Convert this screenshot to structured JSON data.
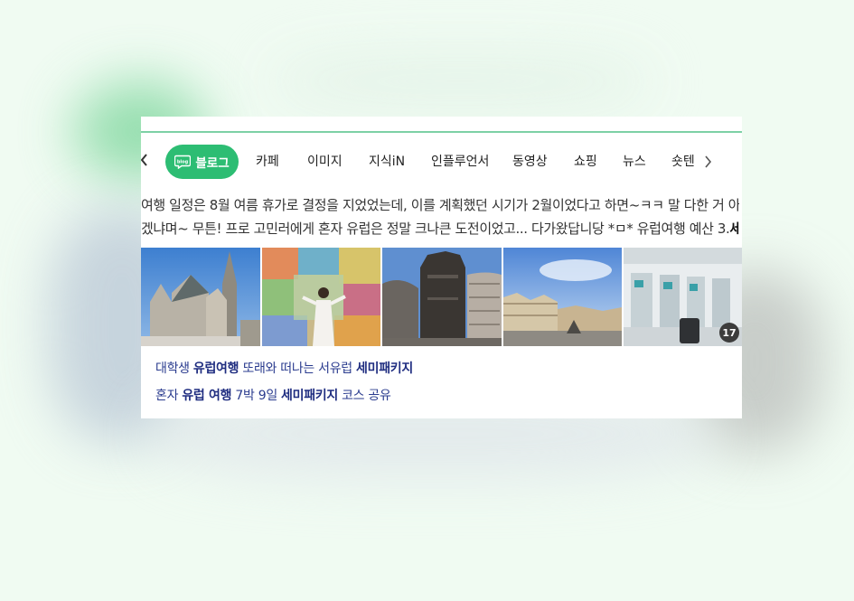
{
  "tabs": {
    "active": "블로그",
    "items": [
      "카페",
      "이미지",
      "지식iN",
      "인플루언서",
      "동영상",
      "쇼핑",
      "뉴스",
      "숏텐"
    ]
  },
  "snippet": {
    "line1": "여행 일정은 8월 여름 휴가로 결정을 지었었는데, 이를 계획했던 시기가 2월이었다고 하면~ㅋㅋ 말 다한 거 아니",
    "line2_text": "겠냐며~ 무튼! 프로 고민러에게 혼자 유럽은 정말 크나큰 도전이었고... 다가왔답니당 *ㅁ* 유럽여행 예산 3.",
    "line2_bold": "세..."
  },
  "gallery": {
    "image_count": "17"
  },
  "related": [
    {
      "parts": [
        {
          "t": "대학생 ",
          "b": false
        },
        {
          "t": "유럽여행",
          "b": true
        },
        {
          "t": " 또래와 떠나는 서유럽 ",
          "b": false
        },
        {
          "t": "세미패키지",
          "b": true
        }
      ]
    },
    {
      "parts": [
        {
          "t": "혼자 ",
          "b": false
        },
        {
          "t": "유럽 여행",
          "b": true
        },
        {
          "t": " 7박 9일 ",
          "b": false
        },
        {
          "t": "세미패키지",
          "b": true
        },
        {
          "t": " 코스 공유",
          "b": false
        }
      ]
    }
  ],
  "colors": {
    "accent": "#2dbd73",
    "link": "#2b3c8f",
    "background": "#f0fbf2"
  }
}
